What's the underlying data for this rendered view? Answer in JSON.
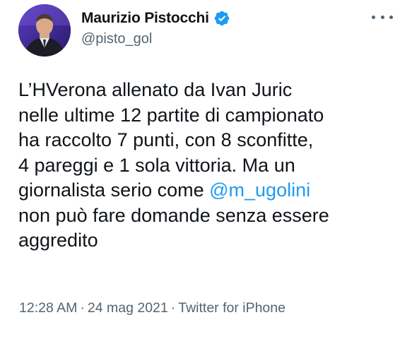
{
  "author": {
    "display_name": "Maurizio Pistocchi",
    "handle": "@pisto_gol",
    "verified": true
  },
  "tweet": {
    "lines": [
      {
        "text": "L’HVerona allenato da Ivan Juric"
      },
      {
        "text": "nelle ultime 12 partite di campionato"
      },
      {
        "text": "ha raccolto 7 punti, con 8 sconfitte,"
      },
      {
        "text": "4 pareggi e 1 sola vittoria. Ma un"
      },
      {
        "before": "giornalista serio come ",
        "mention": "@m_ugolini"
      },
      {
        "text": "non può fare domande senza essere"
      },
      {
        "text": "aggredito"
      }
    ]
  },
  "meta": {
    "time": "12:28 AM",
    "separator": "·",
    "date": "24 mag 2021",
    "source": "Twitter for iPhone"
  },
  "colors": {
    "text": "#0f1419",
    "secondary": "#536471",
    "link": "#1d9bf0",
    "verified_badge": "#1d9bf0"
  },
  "icons": {
    "more": "more-horizontal-icon",
    "verified": "verified-badge-icon"
  }
}
